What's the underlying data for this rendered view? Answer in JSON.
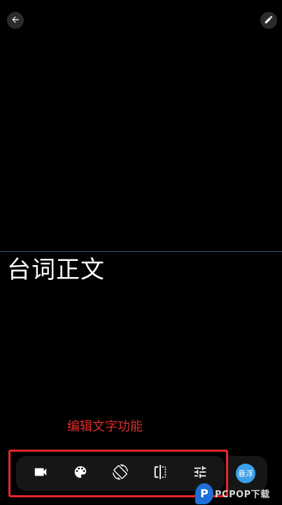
{
  "icons": {
    "back": "arrow-left-icon",
    "edit": "pencil-icon",
    "camera": "video-camera-icon",
    "palette": "palette-icon",
    "rotate": "screen-rotation-icon",
    "mirror": "flip-icon",
    "settings": "sliders-icon"
  },
  "teleprompter": {
    "text": "台词正文"
  },
  "annotation": {
    "label": "编辑文字功能",
    "color": "#e02b2b"
  },
  "toolbar": {
    "float_label": "悬浮"
  },
  "watermark": {
    "badge": "P",
    "text": "PCPOP下载"
  },
  "colors": {
    "background": "#000000",
    "toolbar": "#161616",
    "highlight": "#e8262a",
    "accent": "#3aa0e8",
    "guide_line": "#35596f"
  }
}
